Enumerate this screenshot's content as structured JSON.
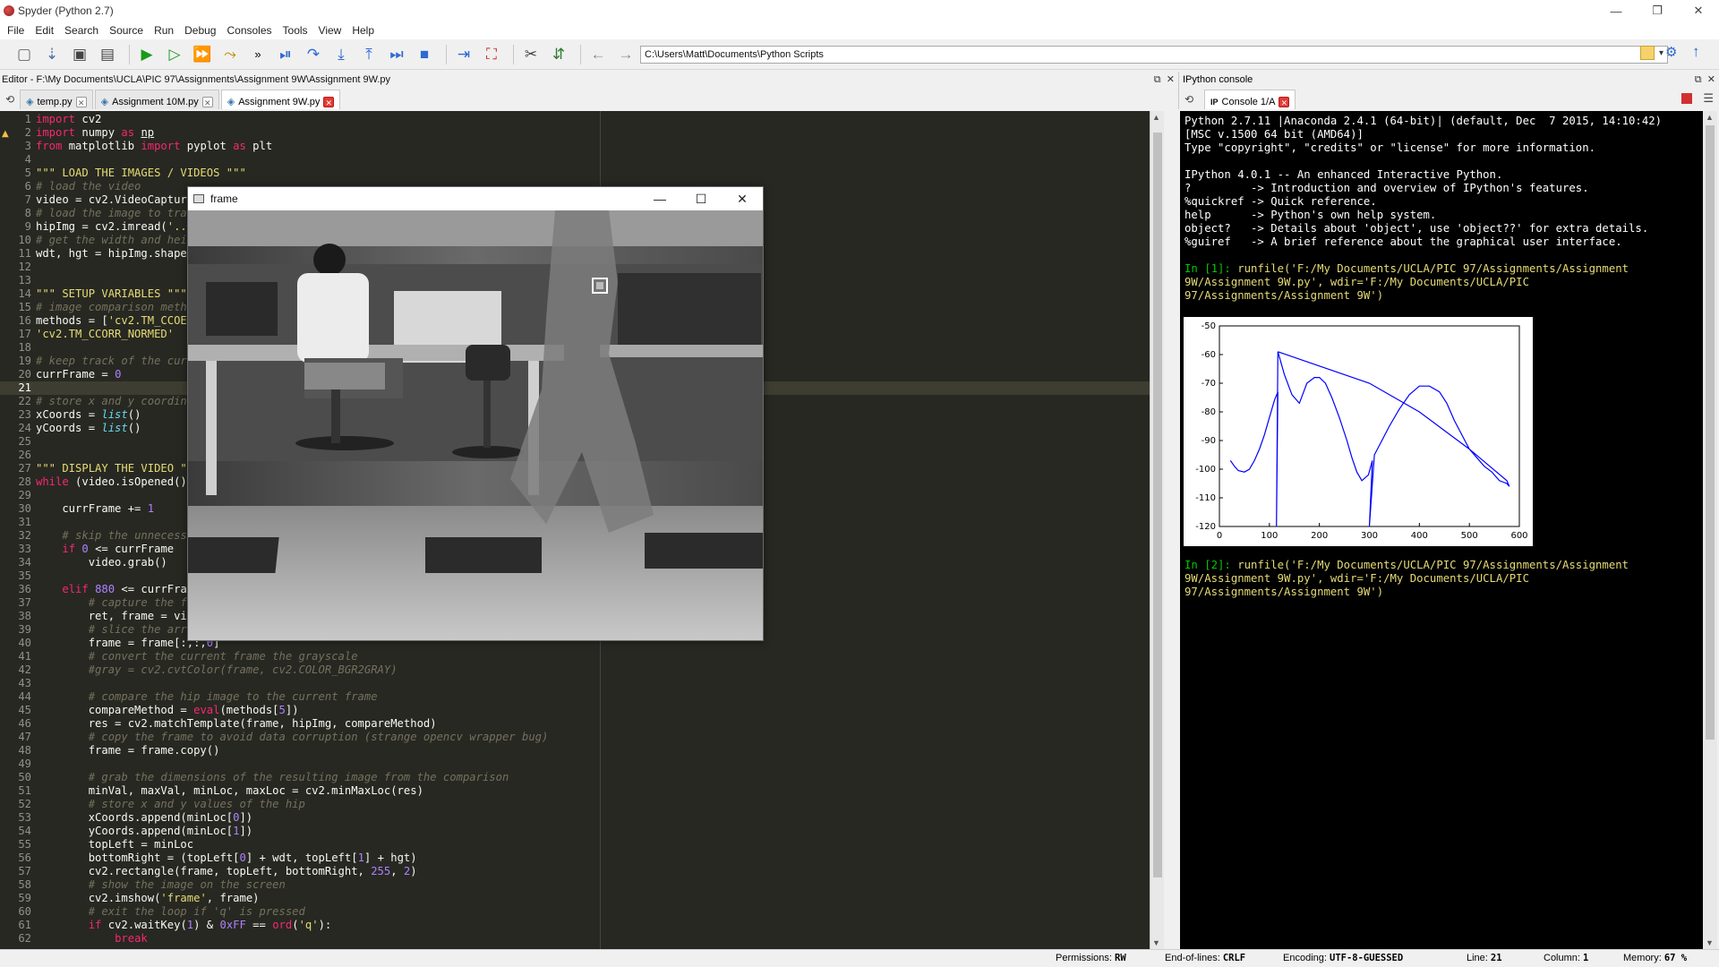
{
  "window": {
    "title": "Spyder (Python 2.7)",
    "controls": [
      "—",
      "❐",
      "✕"
    ]
  },
  "menu": [
    "File",
    "Edit",
    "Search",
    "Source",
    "Run",
    "Debug",
    "Consoles",
    "Tools",
    "View",
    "Help"
  ],
  "toolbar": {
    "path": "C:\\Users\\Matt\\Documents\\Python Scripts",
    "more": "»"
  },
  "editor": {
    "header": "Editor - F:\\My Documents\\UCLA\\PIC 97\\Assignments\\Assignment 9W\\Assignment 9W.py",
    "tabs": [
      {
        "label": "temp.py",
        "active": false
      },
      {
        "label": "Assignment 10M.py",
        "active": false
      },
      {
        "label": "Assignment 9W.py",
        "active": true
      }
    ],
    "current_line": 21
  },
  "frame_window": {
    "title": "frame",
    "controls": [
      "—",
      "☐",
      "✕"
    ]
  },
  "ipython": {
    "header": "IPython console",
    "tab": "Console 1/A",
    "banner": [
      "Python 2.7.11 |Anaconda 2.4.1 (64-bit)| (default, Dec  7 2015, 14:10:42)",
      "[MSC v.1500 64 bit (AMD64)]",
      "Type \"copyright\", \"credits\" or \"license\" for more information.",
      "",
      "IPython 4.0.1 -- An enhanced Interactive Python.",
      "?         -> Introduction and overview of IPython's features.",
      "%quickref -> Quick reference.",
      "help      -> Python's own help system.",
      "object?   -> Details about 'object', use 'object??' for extra details.",
      "%guiref   -> A brief reference about the graphical user interface."
    ],
    "in1_prompt": "In [1]:",
    "in1_cmd": [
      " runfile('F:/My Documents/UCLA/PIC 97/Assignments/Assignment",
      "9W/Assignment 9W.py', wdir='F:/My Documents/UCLA/PIC",
      "97/Assignments/Assignment 9W')"
    ],
    "in2_prompt": "In [2]:",
    "in2_cmd": [
      " runfile('F:/My Documents/UCLA/PIC 97/Assignments/Assignment",
      "9W/Assignment 9W.py', wdir='F:/My Documents/UCLA/PIC",
      "97/Assignments/Assignment 9W')"
    ]
  },
  "chart_data": {
    "type": "line",
    "title": "",
    "xlabel": "",
    "ylabel": "",
    "xlim": [
      0,
      600
    ],
    "ylim": [
      -120,
      -50
    ],
    "xticks": [
      0,
      100,
      200,
      300,
      400,
      500,
      600
    ],
    "yticks": [
      -50,
      -60,
      -70,
      -80,
      -90,
      -100,
      -110,
      -120
    ],
    "color": "#0000ff",
    "series": [
      {
        "x": [
          22,
          30,
          38,
          50,
          60,
          70,
          80,
          90,
          100,
          110,
          117,
          114,
          117,
          130,
          145,
          160,
          175,
          190,
          200,
          212,
          225,
          240,
          255,
          265,
          275,
          285,
          298,
          306,
          300,
          310,
          325,
          340,
          360,
          380,
          400,
          420,
          440,
          455,
          470,
          485,
          500,
          515,
          530,
          545,
          560,
          575,
          580,
          575,
          500,
          400,
          300,
          200,
          117
        ],
        "y": [
          -97,
          -99,
          -100.5,
          -101,
          -100,
          -97,
          -93,
          -88,
          -82,
          -76,
          -73,
          -120,
          -59,
          -67,
          -74,
          -77,
          -70,
          -68,
          -68,
          -70,
          -75,
          -82,
          -90,
          -96,
          -101,
          -104,
          -102,
          -97,
          -120,
          -95,
          -90,
          -85,
          -79,
          -74,
          -71,
          -71,
          -73,
          -77,
          -83,
          -88,
          -93,
          -96,
          -99,
          -101,
          -104,
          -105,
          -106,
          -104,
          -93,
          -80,
          -70,
          -64,
          -59
        ]
      }
    ]
  },
  "status": {
    "permissions_label": "Permissions:",
    "permissions": "RW",
    "eol_label": "End-of-lines:",
    "eol": "CRLF",
    "encoding_label": "Encoding:",
    "encoding": "UTF-8-GUESSED",
    "line_label": "Line:",
    "line": "21",
    "column_label": "Column:",
    "column": "1",
    "memory_label": "Memory:",
    "memory": "67 %"
  },
  "code": [
    {
      "n": 1,
      "h": "<span class='k'>import</span> cv2"
    },
    {
      "n": 2,
      "h": "<span class='k'>import</span> numpy <span class='k'>as</span> <span class='u'>np</span>"
    },
    {
      "n": 3,
      "h": "<span class='k'>from</span> matplotlib <span class='k'>import</span> pyplot <span class='k'>as</span> plt"
    },
    {
      "n": 4,
      "h": ""
    },
    {
      "n": 5,
      "h": "<span class='s'>\"\"\" LOAD THE IMAGES / VIDEOS \"\"\"</span>"
    },
    {
      "n": 6,
      "h": "<span class='c'># load the video</span>"
    },
    {
      "n": 7,
      "h": "video = cv2.VideoCapture(<span class='s'>'...'</span>)"
    },
    {
      "n": 8,
      "h": "<span class='c'># load the image to track</span>"
    },
    {
      "n": 9,
      "h": "hipImg = cv2.imread(<span class='s'>'...'</span>)"
    },
    {
      "n": 10,
      "h": "<span class='c'># get the width and height</span>"
    },
    {
      "n": 11,
      "h": "wdt, hgt = hipImg.shape"
    },
    {
      "n": 12,
      "h": ""
    },
    {
      "n": 13,
      "h": ""
    },
    {
      "n": 14,
      "h": "<span class='s'>\"\"\" SETUP VARIABLES \"\"\"</span>"
    },
    {
      "n": 15,
      "h": "<span class='c'># image comparison methods</span>"
    },
    {
      "n": 16,
      "h": "methods = [<span class='s'>'cv2.TM_CCOEFF'</span>"
    },
    {
      "n": 17,
      "h": "<span class='s'>'cv2.TM_CCORR_NORMED'</span>"
    },
    {
      "n": 18,
      "h": ""
    },
    {
      "n": 19,
      "h": "<span class='c'># keep track of the current frame</span>"
    },
    {
      "n": 20,
      "h": "currFrame = <span class='n'>0</span>"
    },
    {
      "n": 21,
      "h": ""
    },
    {
      "n": 22,
      "h": "<span class='c'># store x and y coordinates</span>"
    },
    {
      "n": 23,
      "h": "xCoords = <span class='b'>list</span>()"
    },
    {
      "n": 24,
      "h": "yCoords = <span class='b'>list</span>()"
    },
    {
      "n": 25,
      "h": ""
    },
    {
      "n": 26,
      "h": ""
    },
    {
      "n": 27,
      "h": "<span class='s'>\"\"\" DISPLAY THE VIDEO \"\"\"</span>"
    },
    {
      "n": 28,
      "h": "<span class='k'>while</span> (video.isOpened()):"
    },
    {
      "n": 29,
      "h": ""
    },
    {
      "n": 30,
      "h": "    currFrame += <span class='n'>1</span>"
    },
    {
      "n": 31,
      "h": ""
    },
    {
      "n": 32,
      "h": "    <span class='c'># skip the unnecessary frames</span>"
    },
    {
      "n": 33,
      "h": "    <span class='k'>if</span> <span class='n'>0</span> &lt;= currFrame"
    },
    {
      "n": 34,
      "h": "        video.grab()"
    },
    {
      "n": 35,
      "h": ""
    },
    {
      "n": 36,
      "h": "    <span class='k'>elif</span> <span class='n'>880</span> &lt;= currFrame"
    },
    {
      "n": 37,
      "h": "        <span class='c'># capture the frame</span>"
    },
    {
      "n": 38,
      "h": "        ret, frame = video.read()"
    },
    {
      "n": 39,
      "h": "        <span class='c'># slice the array</span>"
    },
    {
      "n": 40,
      "h": "        frame = frame[:,:,<span class='n'>0</span>]"
    },
    {
      "n": 41,
      "h": "        <span class='c'># convert the current frame the grayscale</span>"
    },
    {
      "n": 42,
      "h": "        <span class='c'>#gray = cv2.cvtColor(frame, cv2.COLOR_BGR2GRAY)</span>"
    },
    {
      "n": 43,
      "h": ""
    },
    {
      "n": 44,
      "h": "        <span class='c'># compare the hip image to the current frame</span>"
    },
    {
      "n": 45,
      "h": "        compareMethod = <span class='k'>eval</span>(methods[<span class='n'>5</span>])"
    },
    {
      "n": 46,
      "h": "        res = cv2.matchTemplate(frame, hipImg, compareMethod)"
    },
    {
      "n": 47,
      "h": "        <span class='c'># copy the frame to avoid data corruption (strange opencv wrapper bug)</span>"
    },
    {
      "n": 48,
      "h": "        frame = frame.copy()"
    },
    {
      "n": 49,
      "h": ""
    },
    {
      "n": 50,
      "h": "        <span class='c'># grab the dimensions of the resulting image from the comparison</span>"
    },
    {
      "n": 51,
      "h": "        minVal, maxVal, minLoc, maxLoc = cv2.minMaxLoc(res)"
    },
    {
      "n": 52,
      "h": "        <span class='c'># store x and y values of the hip</span>"
    },
    {
      "n": 53,
      "h": "        xCoords.append(minLoc[<span class='n'>0</span>])"
    },
    {
      "n": 54,
      "h": "        yCoords.append(minLoc[<span class='n'>1</span>])"
    },
    {
      "n": 55,
      "h": "        topLeft = minLoc"
    },
    {
      "n": 56,
      "h": "        bottomRight = (topLeft[<span class='n'>0</span>] + wdt, topLeft[<span class='n'>1</span>] + hgt)"
    },
    {
      "n": 57,
      "h": "        cv2.rectangle(frame, topLeft, bottomRight, <span class='n'>255</span>, <span class='n'>2</span>)"
    },
    {
      "n": 58,
      "h": "        <span class='c'># show the image on the screen</span>"
    },
    {
      "n": 59,
      "h": "        cv2.imshow(<span class='s'>'frame'</span>, frame)"
    },
    {
      "n": 60,
      "h": "        <span class='c'># exit the loop if 'q' is pressed</span>"
    },
    {
      "n": 61,
      "h": "        <span class='k'>if</span> cv2.waitKey(<span class='n'>1</span>) &amp; <span class='n'>0xFF</span> == <span class='k'>ord</span>(<span class='s'>'q'</span>):"
    },
    {
      "n": 62,
      "h": "            <span class='k'>break</span>"
    }
  ]
}
